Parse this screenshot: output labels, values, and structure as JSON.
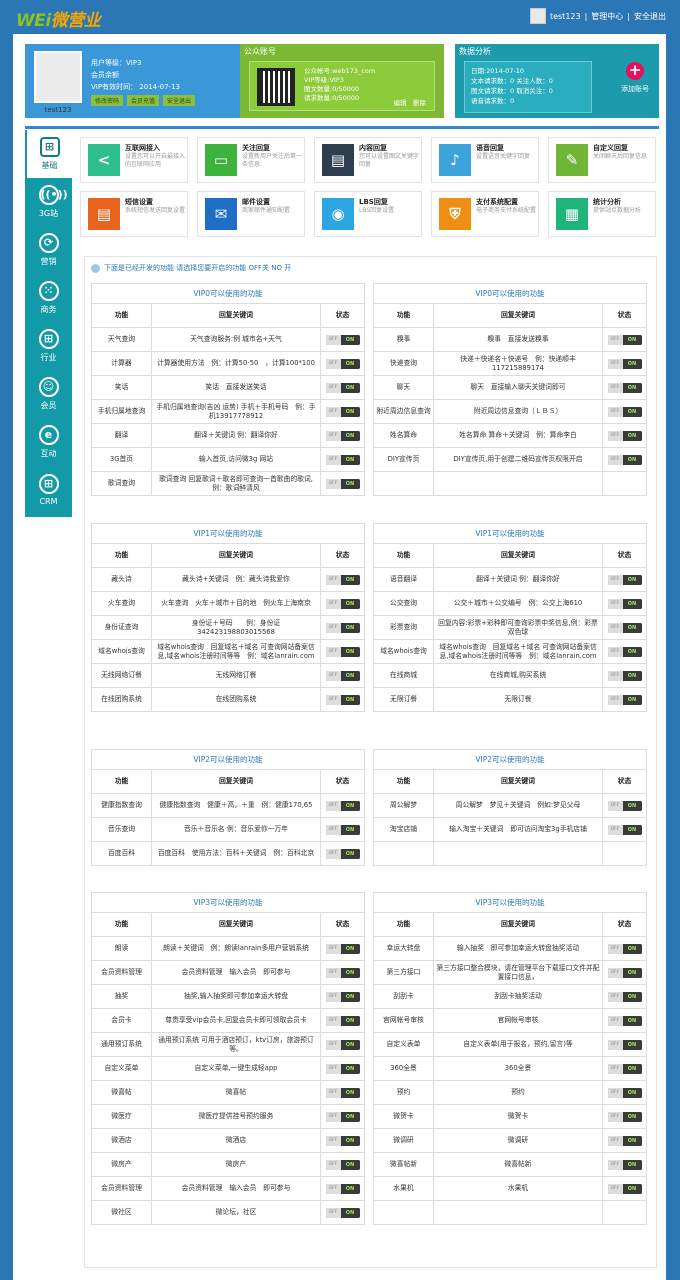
{
  "top": {
    "logo_a": "WEi",
    "logo_b": "微营业",
    "username": "test123",
    "manage": "管理中心",
    "logout": "安全退出"
  },
  "profile": {
    "name": "test123",
    "level": "用户等级：VIP3",
    "member": "会员余额",
    "expire": "VIP有效时间： 2014-07-13",
    "btn_pwd": "修改密码",
    "btn_recharge": "会员充值",
    "btn_logout": "安全退出"
  },
  "account": {
    "title": "公众账号",
    "name": "公众帐号:web173_com",
    "vip": "VIP等级:VIP3",
    "news": "图文数量:0/50000",
    "req": "请求数量:0/50000",
    "edit": "编辑",
    "del": "删除"
  },
  "analysis": {
    "title": "数据分析",
    "date": "日期:2014-07-10",
    "r1": "文本请求数：0  关注人数：0",
    "r2": "图文请求数：0  取消关注：0",
    "r3": "语音请求数：0",
    "add": "添加账号"
  },
  "nav": [
    {
      "label": "基础",
      "icon": "⊞"
    },
    {
      "label": "3G站",
      "icon": "((•))"
    },
    {
      "label": "营销",
      "icon": "⟳"
    },
    {
      "label": "商务",
      "icon": "⁙"
    },
    {
      "label": "行业",
      "icon": "⊞"
    },
    {
      "label": "会员",
      "icon": "☺"
    },
    {
      "label": "互动",
      "icon": "e"
    },
    {
      "label": "CRM",
      "icon": "⊞"
    }
  ],
  "modules": [
    {
      "title": "互联网接入",
      "desc": "设置您可以开启最接入的互联网应用",
      "color": "#2fbf8c",
      "icon": "<"
    },
    {
      "title": "关注回复",
      "desc": "设置新用户关注后第一条信息",
      "color": "#3db33d",
      "icon": "▭"
    },
    {
      "title": "内容回复",
      "desc": "您可以设置图文关键字回复",
      "color": "#2e3d50",
      "icon": "▤"
    },
    {
      "title": "语音回复",
      "desc": "设置语音关键字回复",
      "color": "#3ca3dc",
      "icon": "♪"
    },
    {
      "title": "自定义回复",
      "desc": "关闭聊天后回复信息",
      "color": "#6fb536",
      "icon": "✎"
    },
    {
      "title": "短信设置",
      "desc": "系统短信发送回复设置",
      "color": "#e8641e",
      "icon": "▤"
    },
    {
      "title": "邮件设置",
      "desc": "商家邮件通知配置",
      "color": "#1f6dc4",
      "icon": "✉"
    },
    {
      "title": "LBS回复",
      "desc": "LBS回复设置",
      "color": "#2ba6e0",
      "icon": "◉"
    },
    {
      "title": "支付系统配置",
      "desc": "电子商务支付系统配置",
      "color": "#f08e14",
      "icon": "⛨"
    },
    {
      "title": "统计分析",
      "desc": "提供站点数据分析",
      "color": "#1fb57a",
      "icon": "▦"
    }
  ],
  "notice": "下面是已经开发的功能 请选择您要开启的功能 OFF关 NO 开",
  "th": {
    "func": "功能",
    "kw": "回复关键词",
    "status": "状态"
  },
  "toggle": {
    "off": "OFF",
    "on": "ON"
  },
  "tables": [
    {
      "title": "VIP0可以使用的功能",
      "rows": [
        [
          "天气查询",
          "天气查询服务:例 城市名+天气"
        ],
        [
          "计算器",
          "计算器使用方法　例：计算50-50　，计算100*100"
        ],
        [
          "笑话",
          "笑话　直接发送笑话"
        ],
        [
          "手机归属地查询",
          "手机归属地查询(吉凶 运势) 手机＋手机号码　例：手机13917778912"
        ],
        [
          "翻译",
          "翻译＋关键词 例：翻译你好"
        ],
        [
          "3G首页",
          "输入首页,访问微3g 网站"
        ],
        [
          "歌词查询",
          "歌词查询 回复歌词＋歌名即可查询一首歌曲的歌词,例：歌词醉清风"
        ]
      ]
    },
    {
      "title": "VIP0可以使用的功能",
      "rows": [
        [
          "糗事",
          "糗事　直接发送糗事"
        ],
        [
          "快递查询",
          "快递＋快递名＋快递号　例：快递顺丰117215889174"
        ],
        [
          "聊天",
          "聊天　直接输入聊天关键词即可"
        ],
        [
          "附近周边信息查询",
          "附近周边信息查询（ＬＢＳ）"
        ],
        [
          "姓名算命",
          "姓名算命 算命＋关键词　例：算命李白"
        ],
        [
          "DIY宣传页",
          "DIY宣传页,用于创建二维码宣传页权限开启"
        ],
        [
          "",
          ""
        ]
      ]
    },
    {
      "title": "VIP1可以使用的功能",
      "rows": [
        [
          "藏头诗",
          "藏头诗+关键词　例：藏头诗我爱你"
        ],
        [
          "火车查询",
          "火车查询　火车＋城市＋目的地　例火车上海南京"
        ],
        [
          "身份证查询",
          "身份证＋号码　　例：身份证342423198803015568"
        ],
        [
          "域名whois查询",
          "域名whois查询　回复域名＋域名 可查询网站备案信息,域名whois注册时间等等　例：域名lanrain.com"
        ],
        [
          "无线网络订餐",
          "无线网络订餐"
        ],
        [
          "在线团购系统",
          "在线团购系统"
        ]
      ]
    },
    {
      "title": "VIP1可以使用的功能",
      "rows": [
        [
          "语音翻译",
          "翻译＋关键词 例：翻译你好"
        ],
        [
          "公交查询",
          "公交＋城市＋公交编号　例：公交上海610"
        ],
        [
          "彩票查询",
          "回复内容:彩票+彩种即可查询彩票中奖信息,例：彩票双色球"
        ],
        [
          "域名whois查询",
          "域名whois查询　回复域名＋域名 可查询网站备案信息,域名whois注册时间等等　例：域名lanrain.com"
        ],
        [
          "在线商城",
          "在线商城,购买系统"
        ],
        [
          "无限订餐",
          "无限订餐"
        ]
      ]
    },
    {
      "title": "VIP2可以使用的功能",
      "rows": [
        [
          "健康指数查询",
          "健康指数查询　健康＋高，＋重　例：健康170,65"
        ],
        [
          "音乐查询",
          "音乐＋音乐名 例：音乐爱你一万年"
        ],
        [
          "百度百科",
          "百度百科　使用方法：百科＋关键词　例：百科北京"
        ]
      ]
    },
    {
      "title": "VIP2可以使用的功能",
      "rows": [
        [
          "周公解梦",
          "周公解梦　梦见＋关键词　例如:梦见父母"
        ],
        [
          "淘宝店铺",
          "输入淘宝＋关键词　即可访问淘宝3g手机店铺"
        ],
        [
          "",
          ""
        ]
      ]
    },
    {
      "title": "VIP3可以使用的功能",
      "rows": [
        [
          "朗读",
          "朗读＋关键词　例：朗读lanrain多用户营销系统"
        ],
        [
          "会员资料管理",
          "会员资料管理　输入会员　即可参与"
        ],
        [
          "抽奖",
          "抽奖,输入抽奖即可参加幸运大转盘"
        ],
        [
          "会员卡",
          "尊贵享受vip会员卡,回复会员卡即可领取会员卡"
        ],
        [
          "通用预订系统",
          "通用预订系统 可用于酒店预订，ktv订房，旅游预订等。"
        ],
        [
          "自定义菜单",
          "自定义菜单,一键生成轻app"
        ],
        [
          "微喜帖",
          "微喜帖"
        ],
        [
          "微医疗",
          "微医疗提供挂号预约服务"
        ],
        [
          "微酒店",
          "微酒店"
        ],
        [
          "微房产",
          "微房产"
        ],
        [
          "会员资料管理",
          "会员资料管理　输入会员　即可参与"
        ],
        [
          "微社区",
          "微论坛，社区"
        ]
      ]
    },
    {
      "title": "VIP3可以使用的功能",
      "rows": [
        [
          "幸运大转盘",
          "输入抽奖　即可参加幸运大转盘抽奖活动"
        ],
        [
          "第三方接口",
          "第三方接口整合模块，请在管理平台下载接口文件并配置接口信息，"
        ],
        [
          "刮刮卡",
          "刮刮卡抽奖活动"
        ],
        [
          "官网帐号审核",
          "官网帐号审核"
        ],
        [
          "自定义表单",
          "自定义表单(用于报名，预约,留言)等"
        ],
        [
          "360全景",
          "360全景"
        ],
        [
          "预约",
          "预约"
        ],
        [
          "微贺卡",
          "微贺卡"
        ],
        [
          "微调研",
          "微调研"
        ],
        [
          "微喜帖新",
          "微喜帖新"
        ],
        [
          "水果机",
          "水果机"
        ],
        [
          "",
          ""
        ]
      ]
    }
  ]
}
